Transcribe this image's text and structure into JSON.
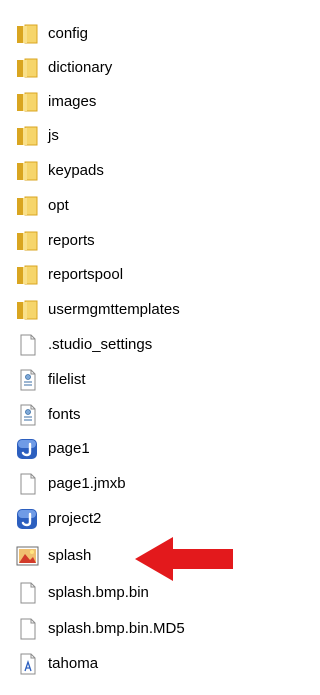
{
  "colors": {
    "folder_dark": "#d9a520",
    "folder_light": "#f6d56b",
    "arrow": "#e3191c",
    "page_border": "#8c8c8c"
  },
  "files": [
    {
      "name": "config",
      "icon": "folder-icon"
    },
    {
      "name": "dictionary",
      "icon": "folder-icon"
    },
    {
      "name": "images",
      "icon": "folder-icon"
    },
    {
      "name": "js",
      "icon": "folder-icon"
    },
    {
      "name": "keypads",
      "icon": "folder-icon"
    },
    {
      "name": "opt",
      "icon": "folder-icon"
    },
    {
      "name": "reports",
      "icon": "folder-icon"
    },
    {
      "name": "reportspool",
      "icon": "folder-icon"
    },
    {
      "name": "usermgmttemplates",
      "icon": "folder-icon"
    },
    {
      "name": ".studio_settings",
      "icon": "blank-file-icon"
    },
    {
      "name": "filelist",
      "icon": "config-file-icon"
    },
    {
      "name": "fonts",
      "icon": "config-file-icon"
    },
    {
      "name": "page1",
      "icon": "jmx-app-icon"
    },
    {
      "name": "page1.jmxb",
      "icon": "blank-file-icon"
    },
    {
      "name": "project2",
      "icon": "jmx-app-icon"
    },
    {
      "name": "splash",
      "icon": "image-file-icon"
    },
    {
      "name": "splash.bmp.bin",
      "icon": "blank-file-icon"
    },
    {
      "name": "splash.bmp.bin.MD5",
      "icon": "blank-file-icon"
    },
    {
      "name": "tahoma",
      "icon": "font-file-icon"
    }
  ],
  "highlighted_file": "splash"
}
